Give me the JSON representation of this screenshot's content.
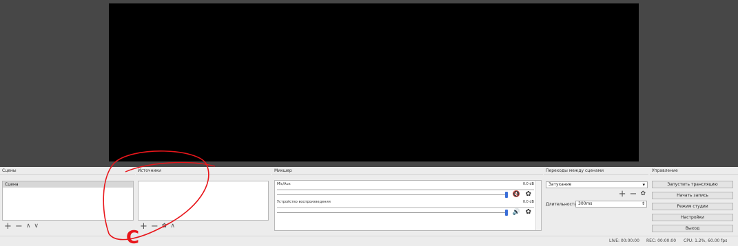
{
  "docks": {
    "scenes": {
      "title": "Сцены",
      "items": [
        "Сцена"
      ]
    },
    "sources": {
      "title": "Источники"
    },
    "mixer": {
      "title": "Микшер",
      "channels": [
        {
          "name": "Mic/Aux",
          "db": "0.0 dB",
          "muted": true
        },
        {
          "name": "Устройство воспроизведения",
          "db": "0.0 dB",
          "muted": false
        }
      ]
    },
    "transitions": {
      "title": "Переходы между сценами",
      "selected": "Затухание",
      "duration_label": "Длительность",
      "duration_value": "300ms"
    },
    "controls": {
      "title": "Управление",
      "buttons": [
        "Запустить трансляцию",
        "Начать запись",
        "Режим студии",
        "Настройки",
        "Выход"
      ]
    }
  },
  "status": {
    "live": "LIVE: 00:00:00",
    "rec": "REC: 00:00:00",
    "cpu": "CPU: 1.2%, 60.00 fps"
  },
  "icons": {
    "add": "+",
    "remove": "−",
    "up": "∧",
    "down": "∨",
    "gear": "✿",
    "speaker_muted": "🔇",
    "speaker": "🔊",
    "dropdown": "▾"
  },
  "colors": {
    "preview_bg": "#474747",
    "canvas": "#000000",
    "accent_fader": "#3a6ed8",
    "muted_icon": "#c0392b",
    "annotation": "#e8161b"
  },
  "annotation": {
    "letter": "C"
  }
}
